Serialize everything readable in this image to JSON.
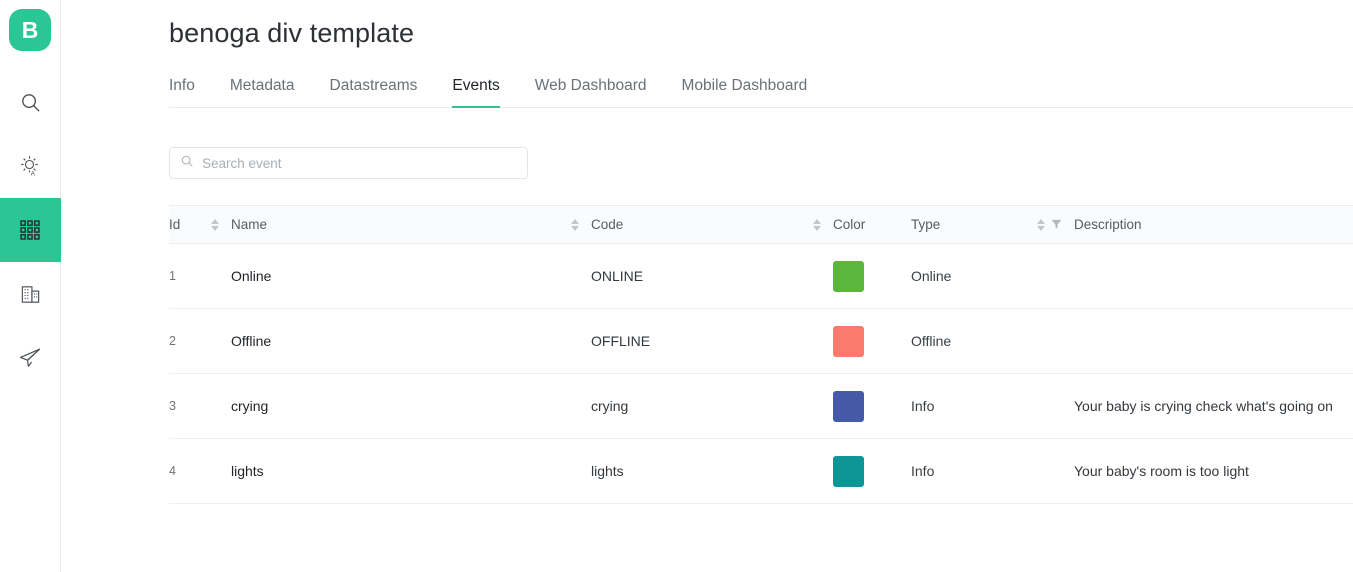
{
  "brand": {
    "logo_letter": "B",
    "accent_color": "#2bc693"
  },
  "sidebar": {
    "items": [
      {
        "icon": "search-icon",
        "name": "search",
        "active": false
      },
      {
        "icon": "brightness-icon",
        "name": "brightness",
        "active": false
      },
      {
        "icon": "apps-grid-icon",
        "name": "apps",
        "active": true
      },
      {
        "icon": "building-icon",
        "name": "organization",
        "active": false
      },
      {
        "icon": "send-icon",
        "name": "send",
        "active": false
      }
    ]
  },
  "header": {
    "title": "benoga div template"
  },
  "tabs": [
    {
      "label": "Info",
      "active": false
    },
    {
      "label": "Metadata",
      "active": false
    },
    {
      "label": "Datastreams",
      "active": false
    },
    {
      "label": "Events",
      "active": true
    },
    {
      "label": "Web Dashboard",
      "active": false
    },
    {
      "label": "Mobile Dashboard",
      "active": false
    }
  ],
  "search": {
    "placeholder": "Search event",
    "value": "",
    "icon": "search-icon"
  },
  "table": {
    "columns": [
      {
        "label": "Id",
        "sortable": true,
        "filterable": false
      },
      {
        "label": "Name",
        "sortable": true,
        "filterable": false
      },
      {
        "label": "Code",
        "sortable": true,
        "filterable": false
      },
      {
        "label": "Color",
        "sortable": false,
        "filterable": false
      },
      {
        "label": "Type",
        "sortable": true,
        "filterable": true
      },
      {
        "label": "Description",
        "sortable": false,
        "filterable": false
      }
    ],
    "rows": [
      {
        "id": "1",
        "name": "Online",
        "code": "ONLINE",
        "color": "#5cb63c",
        "type": "Online",
        "description": ""
      },
      {
        "id": "2",
        "name": "Offline",
        "code": "OFFLINE",
        "color": "#fa7b6e",
        "type": "Offline",
        "description": ""
      },
      {
        "id": "3",
        "name": "crying",
        "code": "crying",
        "color": "#4459a8",
        "type": "Info",
        "description": "Your baby is crying check what's going on"
      },
      {
        "id": "4",
        "name": "lights",
        "code": "lights",
        "color": "#0d9695",
        "type": "Info",
        "description": "Your baby's room is too light"
      }
    ]
  }
}
